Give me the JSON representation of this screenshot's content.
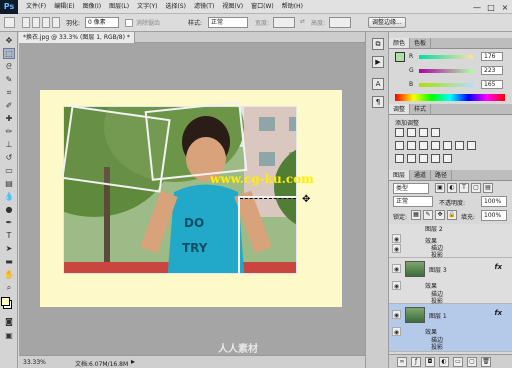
{
  "app": {
    "logo": "Ps"
  },
  "menu": [
    "文件(F)",
    "编辑(E)",
    "图像(I)",
    "图层(L)",
    "文字(Y)",
    "选择(S)",
    "滤镜(T)",
    "视图(V)",
    "窗口(W)",
    "帮助(H)"
  ],
  "window_controls": [
    "—",
    "□",
    "×"
  ],
  "options": {
    "feather_label": "羽化:",
    "feather_value": "0 像素",
    "antialias_label": "消除锯齿",
    "style_label": "样式:",
    "style_value": "正常",
    "width_label": "宽度:",
    "height_label": "高度:",
    "refine_button": "调整边缘..."
  },
  "document": {
    "tab_title": "*换衣.jpg @ 33.3% (图层 1, RGB/8) *",
    "zoom": "33.33%",
    "status": "文档:6.07M/16.8M",
    "watermark": "www.cg-ku.com",
    "corner_logo": "人人素材"
  },
  "color_panel": {
    "tabs": [
      "颜色",
      "色板"
    ],
    "sliders": [
      {
        "label": "R",
        "value": "176"
      },
      {
        "label": "G",
        "value": "223"
      },
      {
        "label": "B",
        "value": "165"
      }
    ]
  },
  "adjustments_panel": {
    "tabs": [
      "调整",
      "样式"
    ],
    "title": "添加调整"
  },
  "layers_panel": {
    "tabs": [
      "图层",
      "通道",
      "路径"
    ],
    "kind_label": "类型",
    "blend_mode": "正常",
    "opacity_label": "不透明度:",
    "opacity_value": "100%",
    "lock_label": "锁定:",
    "fill_label": "填充:",
    "fill_value": "100%",
    "layers": [
      {
        "name": "图层 2",
        "effects_label": "效果",
        "effects": [
          "描边",
          "投影"
        ]
      },
      {
        "name": "图层 3",
        "effects_label": "效果",
        "effects": [
          "描边",
          "投影"
        ]
      },
      {
        "name": "图层 1",
        "effects_label": "效果",
        "effects": [
          "描边",
          "投影"
        ]
      }
    ],
    "fx_label": "fx"
  },
  "colors": {
    "accent_selected": "#b5c9e9",
    "canvas_bg": "#fdf9c8",
    "workspace": "#a5a5a5",
    "watermark": "#ffee00"
  }
}
